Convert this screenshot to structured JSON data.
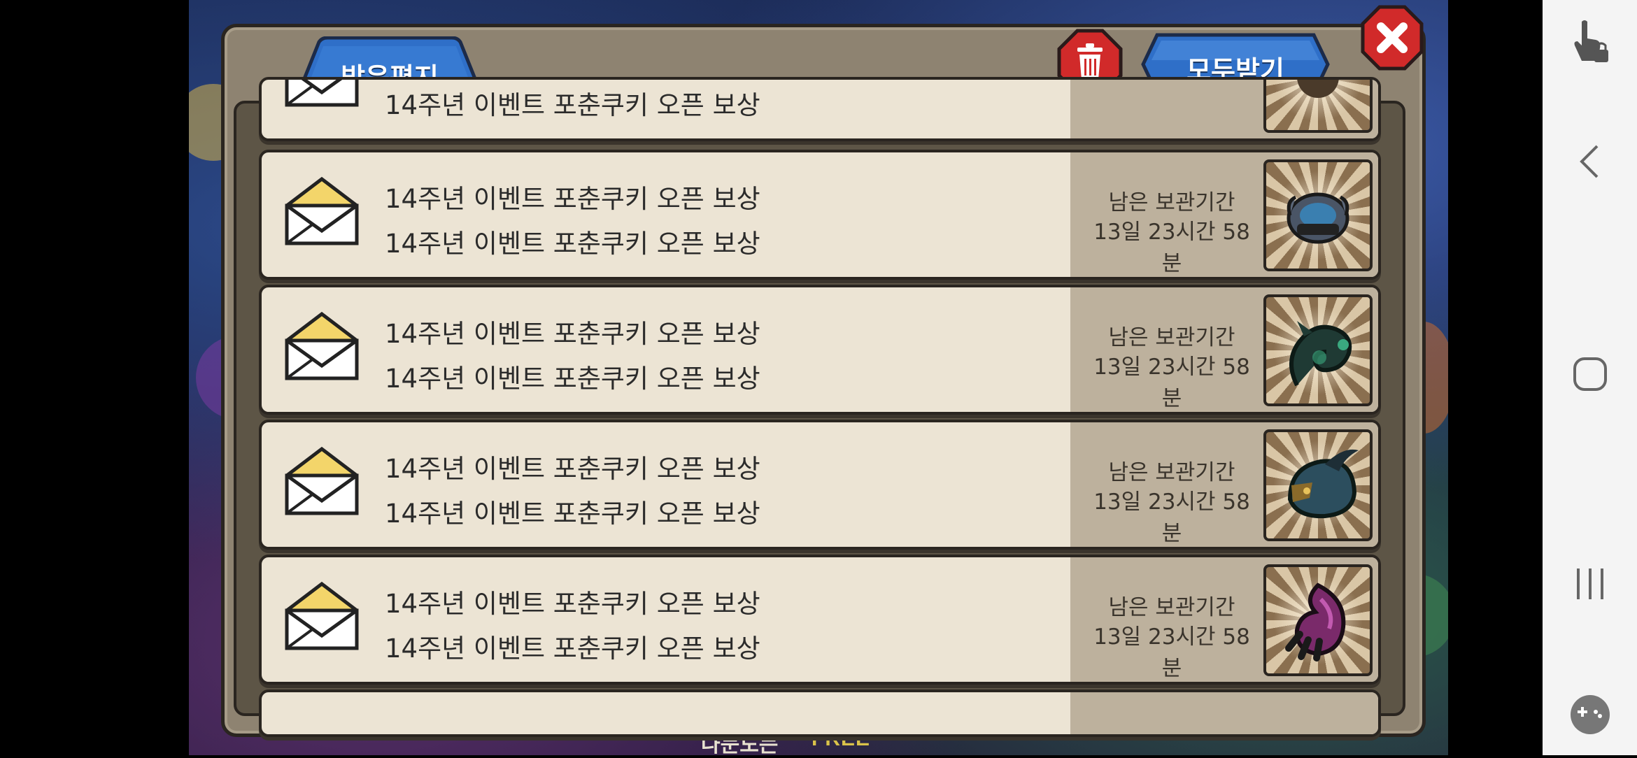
{
  "mailbox": {
    "tab_label": "받은편지",
    "receive_all_label": "모두받기",
    "items": [
      {
        "line1": "14주년 이벤트 포춘쿠키 오픈 보상",
        "line2": "14주년 이벤트 포춘쿠키 오픈 보상",
        "period_label": "",
        "period_value": "",
        "item_icon": "reward-item-icon"
      },
      {
        "line1": "14주년 이벤트 포춘쿠키 오픈 보상",
        "line2": "14주년 이벤트 포춘쿠키 오픈 보상",
        "period_label": "남은 보관기간",
        "period_value": "13일 23시간 58분",
        "item_icon": "helmet-reward-icon"
      },
      {
        "line1": "14주년 이벤트 포춘쿠키 오픈 보상",
        "line2": "14주년 이벤트 포춘쿠키 오픈 보상",
        "period_label": "남은 보관기간",
        "period_value": "13일 23시간 58분",
        "item_icon": "dragon-reward-icon"
      },
      {
        "line1": "14주년 이벤트 포춘쿠키 오픈 보상",
        "line2": "14주년 이벤트 포춘쿠키 오픈 보상",
        "period_label": "남은 보관기간",
        "period_value": "13일 23시간 58분",
        "item_icon": "horn-helmet-reward-icon"
      },
      {
        "line1": "14주년 이벤트 포춘쿠키 오픈 보상",
        "line2": "14주년 이벤트 포춘쿠키 오픈 보상",
        "period_label": "남은 보관기간",
        "period_value": "13일 23시간 58분",
        "item_icon": "flame-claw-reward-icon"
      }
    ]
  },
  "background": {
    "free_label": "FREE",
    "partial_label": "나눈도는"
  },
  "navbar": {
    "buttons": [
      "touch-lock-icon",
      "back-icon",
      "home-icon",
      "recent-apps-icon",
      "game-tools-icon"
    ]
  }
}
